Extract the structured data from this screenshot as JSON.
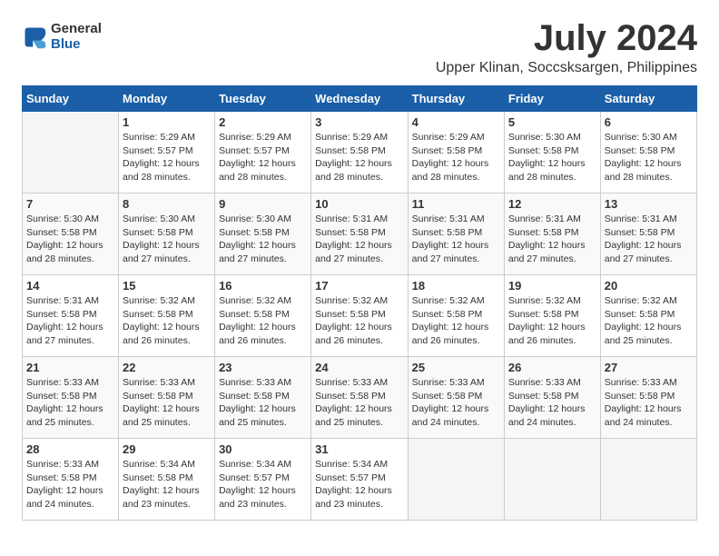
{
  "logo": {
    "general": "General",
    "blue": "Blue"
  },
  "title": "July 2024",
  "location": "Upper Klinan, Soccsksargen, Philippines",
  "days_header": [
    "Sunday",
    "Monday",
    "Tuesday",
    "Wednesday",
    "Thursday",
    "Friday",
    "Saturday"
  ],
  "weeks": [
    [
      {
        "day": "",
        "info": ""
      },
      {
        "day": "1",
        "info": "Sunrise: 5:29 AM\nSunset: 5:57 PM\nDaylight: 12 hours\nand 28 minutes."
      },
      {
        "day": "2",
        "info": "Sunrise: 5:29 AM\nSunset: 5:57 PM\nDaylight: 12 hours\nand 28 minutes."
      },
      {
        "day": "3",
        "info": "Sunrise: 5:29 AM\nSunset: 5:58 PM\nDaylight: 12 hours\nand 28 minutes."
      },
      {
        "day": "4",
        "info": "Sunrise: 5:29 AM\nSunset: 5:58 PM\nDaylight: 12 hours\nand 28 minutes."
      },
      {
        "day": "5",
        "info": "Sunrise: 5:30 AM\nSunset: 5:58 PM\nDaylight: 12 hours\nand 28 minutes."
      },
      {
        "day": "6",
        "info": "Sunrise: 5:30 AM\nSunset: 5:58 PM\nDaylight: 12 hours\nand 28 minutes."
      }
    ],
    [
      {
        "day": "7",
        "info": "Sunrise: 5:30 AM\nSunset: 5:58 PM\nDaylight: 12 hours\nand 28 minutes."
      },
      {
        "day": "8",
        "info": "Sunrise: 5:30 AM\nSunset: 5:58 PM\nDaylight: 12 hours\nand 27 minutes."
      },
      {
        "day": "9",
        "info": "Sunrise: 5:30 AM\nSunset: 5:58 PM\nDaylight: 12 hours\nand 27 minutes."
      },
      {
        "day": "10",
        "info": "Sunrise: 5:31 AM\nSunset: 5:58 PM\nDaylight: 12 hours\nand 27 minutes."
      },
      {
        "day": "11",
        "info": "Sunrise: 5:31 AM\nSunset: 5:58 PM\nDaylight: 12 hours\nand 27 minutes."
      },
      {
        "day": "12",
        "info": "Sunrise: 5:31 AM\nSunset: 5:58 PM\nDaylight: 12 hours\nand 27 minutes."
      },
      {
        "day": "13",
        "info": "Sunrise: 5:31 AM\nSunset: 5:58 PM\nDaylight: 12 hours\nand 27 minutes."
      }
    ],
    [
      {
        "day": "14",
        "info": "Sunrise: 5:31 AM\nSunset: 5:58 PM\nDaylight: 12 hours\nand 27 minutes."
      },
      {
        "day": "15",
        "info": "Sunrise: 5:32 AM\nSunset: 5:58 PM\nDaylight: 12 hours\nand 26 minutes."
      },
      {
        "day": "16",
        "info": "Sunrise: 5:32 AM\nSunset: 5:58 PM\nDaylight: 12 hours\nand 26 minutes."
      },
      {
        "day": "17",
        "info": "Sunrise: 5:32 AM\nSunset: 5:58 PM\nDaylight: 12 hours\nand 26 minutes."
      },
      {
        "day": "18",
        "info": "Sunrise: 5:32 AM\nSunset: 5:58 PM\nDaylight: 12 hours\nand 26 minutes."
      },
      {
        "day": "19",
        "info": "Sunrise: 5:32 AM\nSunset: 5:58 PM\nDaylight: 12 hours\nand 26 minutes."
      },
      {
        "day": "20",
        "info": "Sunrise: 5:32 AM\nSunset: 5:58 PM\nDaylight: 12 hours\nand 25 minutes."
      }
    ],
    [
      {
        "day": "21",
        "info": "Sunrise: 5:33 AM\nSunset: 5:58 PM\nDaylight: 12 hours\nand 25 minutes."
      },
      {
        "day": "22",
        "info": "Sunrise: 5:33 AM\nSunset: 5:58 PM\nDaylight: 12 hours\nand 25 minutes."
      },
      {
        "day": "23",
        "info": "Sunrise: 5:33 AM\nSunset: 5:58 PM\nDaylight: 12 hours\nand 25 minutes."
      },
      {
        "day": "24",
        "info": "Sunrise: 5:33 AM\nSunset: 5:58 PM\nDaylight: 12 hours\nand 25 minutes."
      },
      {
        "day": "25",
        "info": "Sunrise: 5:33 AM\nSunset: 5:58 PM\nDaylight: 12 hours\nand 24 minutes."
      },
      {
        "day": "26",
        "info": "Sunrise: 5:33 AM\nSunset: 5:58 PM\nDaylight: 12 hours\nand 24 minutes."
      },
      {
        "day": "27",
        "info": "Sunrise: 5:33 AM\nSunset: 5:58 PM\nDaylight: 12 hours\nand 24 minutes."
      }
    ],
    [
      {
        "day": "28",
        "info": "Sunrise: 5:33 AM\nSunset: 5:58 PM\nDaylight: 12 hours\nand 24 minutes."
      },
      {
        "day": "29",
        "info": "Sunrise: 5:34 AM\nSunset: 5:58 PM\nDaylight: 12 hours\nand 23 minutes."
      },
      {
        "day": "30",
        "info": "Sunrise: 5:34 AM\nSunset: 5:57 PM\nDaylight: 12 hours\nand 23 minutes."
      },
      {
        "day": "31",
        "info": "Sunrise: 5:34 AM\nSunset: 5:57 PM\nDaylight: 12 hours\nand 23 minutes."
      },
      {
        "day": "",
        "info": ""
      },
      {
        "day": "",
        "info": ""
      },
      {
        "day": "",
        "info": ""
      }
    ]
  ]
}
